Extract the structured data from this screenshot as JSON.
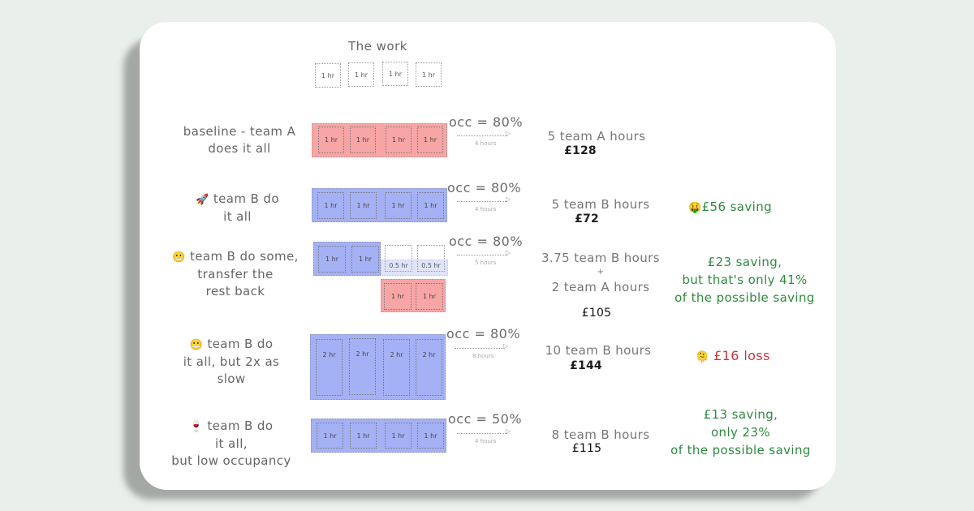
{
  "header": {
    "title": "The work"
  },
  "work_tasks": [
    "1 hr",
    "1 hr",
    "1 hr",
    "1 hr"
  ],
  "colors": {
    "team_a": "#f8a5a6",
    "team_b": "#a5b1f5",
    "team_b_light": "#dfe4fb",
    "saving_green": "#2f8a3e",
    "loss_red": "#c9363c",
    "background": "#e9efeb"
  },
  "scenarios": [
    {
      "label_lines": [
        "baseline - team A",
        "does it all"
      ],
      "icon": "",
      "tasks": [
        "1 hr",
        "1 hr",
        "1 hr",
        "1 hr"
      ],
      "occ": "occ = 80%",
      "duration": "4 hours",
      "hours_lines": [
        "5 team A hours"
      ],
      "cost": "£128",
      "outcome_lines": []
    },
    {
      "label_lines": [
        "team B do",
        "it all"
      ],
      "icon": "🚀",
      "tasks": [
        "1 hr",
        "1 hr",
        "1 hr",
        "1 hr"
      ],
      "occ": "occ = 80%",
      "duration": "4 hours",
      "hours_lines": [
        "5 team B hours"
      ],
      "cost": "£72",
      "outcome_icon": "🤑",
      "outcome_lines": [
        "£56 saving"
      ]
    },
    {
      "label_lines": [
        "team B do some,",
        "transfer the",
        "rest back"
      ],
      "icon": "😬",
      "tasks_b": [
        "1 hr",
        "1 hr"
      ],
      "tasks_b_partial": [
        "0.5 hr",
        "0.5 hr"
      ],
      "tasks_a": [
        "1 hr",
        "1 hr"
      ],
      "occ": "occ = 80%",
      "duration": "5 hours",
      "hours_lines": [
        "3.75 team B hours",
        "+",
        "2 team A hours"
      ],
      "cost": "£105",
      "outcome_lines": [
        "£23 saving,",
        "but that's only 41%",
        "of the possible saving"
      ]
    },
    {
      "label_lines": [
        "team B do",
        "it all, but 2x as",
        "slow"
      ],
      "icon": "😬",
      "tasks": [
        "2 hr",
        "2 hr",
        "2 hr",
        "2 hr"
      ],
      "occ": "occ = 80%",
      "duration": "8 hours",
      "hours_lines": [
        "10 team B hours"
      ],
      "cost": "£144",
      "outcome_icon": "🫠",
      "outcome_lines": [
        "£16 loss"
      ]
    },
    {
      "label_lines": [
        "team B do",
        "it all,",
        "but low occupancy"
      ],
      "icon": "🍷",
      "tasks": [
        "1 hr",
        "1 hr",
        "1 hr",
        "1 hr"
      ],
      "occ": "occ = 50%",
      "duration": "4 hours",
      "hours_lines": [
        "8 team B hours"
      ],
      "cost": "£115",
      "outcome_lines": [
        "£13 saving,",
        "only 23%",
        "of the possible saving"
      ]
    }
  ]
}
